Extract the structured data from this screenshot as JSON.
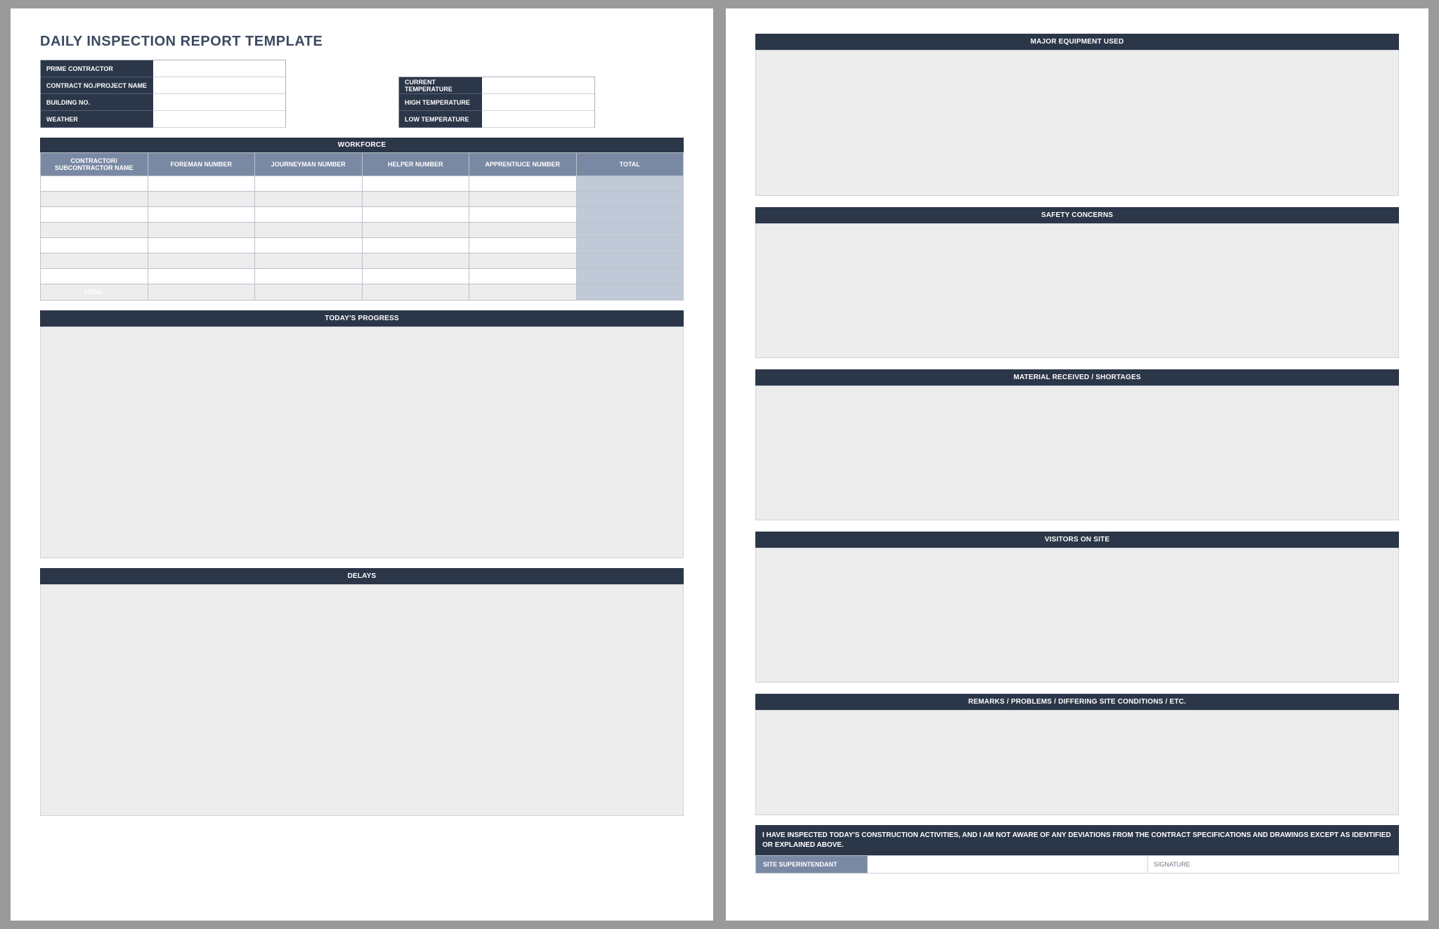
{
  "title": "DAILY INSPECTION REPORT TEMPLATE",
  "header_left": {
    "prime_contractor": "PRIME CONTRACTOR",
    "contract_no": "CONTRACT NO./PROJECT NAME",
    "building_no": "BUILDING NO.",
    "weather": "WEATHER"
  },
  "header_right": {
    "current_temp": "CURRENT TEMPERATURE",
    "high_temp": "HIGH TEMPERATURE",
    "low_temp": "LOW TEMPERATURE"
  },
  "workforce": {
    "heading": "WORKFORCE",
    "cols": {
      "contractor": "CONTRACTOR/ SUBCONTRACTOR NAME",
      "foreman": "FOREMAN NUMBER",
      "journeyman": "JOURNEYMAN NUMBER",
      "helper": "HELPER NUMBER",
      "apprentice": "APPRENTIUCE NUMBER",
      "total": "TOTAL"
    },
    "total_label": "TOTAL"
  },
  "sections": {
    "progress": "TODAY'S PROGRESS",
    "delays": "DELAYS",
    "equipment": "MAJOR EQUIPMENT USED",
    "safety": "SAFETY CONCERNS",
    "material": "MATERIAL RECEIVED / SHORTAGES",
    "visitors": "VISITORS ON SITE",
    "remarks": "REMARKS / PROBLEMS / DIFFERING SITE CONDITIONS / ETC."
  },
  "inspection_statement": "I HAVE INSPECTED TODAY'S CONSTRUCTION ACTIVITIES, AND I AM NOT AWARE OF ANY DEVIATIONS FROM THE CONTRACT SPECIFICATIONS AND DRAWINGS EXCEPT AS IDENTIFIED OR EXPLAINED ABOVE.",
  "signature": {
    "superintendant": "SITE SUPERINTENDANT",
    "signature": "SIGNATURE"
  }
}
